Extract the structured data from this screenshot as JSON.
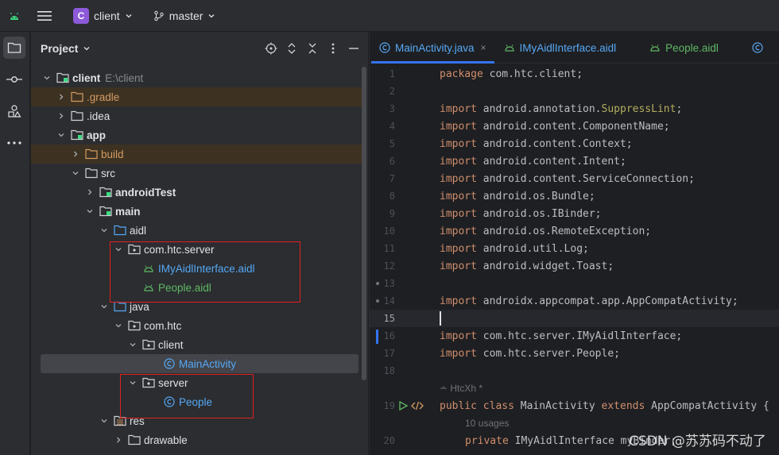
{
  "titlebar": {
    "project_initial": "C",
    "project_name": "client",
    "branch": "master"
  },
  "panel": {
    "title": "Project"
  },
  "tree": [
    {
      "label": "client",
      "path": "E:\\client"
    },
    {
      "label": ".gradle"
    },
    {
      "label": ".idea"
    },
    {
      "label": "app"
    },
    {
      "label": "build"
    },
    {
      "label": "src"
    },
    {
      "label": "androidTest"
    },
    {
      "label": "main"
    },
    {
      "label": "aidl"
    },
    {
      "label": "com.htc.server"
    },
    {
      "label": "IMyAidlInterface.aidl"
    },
    {
      "label": "People.aidl"
    },
    {
      "label": "java"
    },
    {
      "label": "com.htc"
    },
    {
      "label": "client"
    },
    {
      "label": "MainActivity"
    },
    {
      "label": "server"
    },
    {
      "label": "People"
    },
    {
      "label": "res"
    },
    {
      "label": "drawable"
    }
  ],
  "tabs": [
    {
      "label": "MainActivity.java",
      "close": "×"
    },
    {
      "label": "IMyAidlInterface.aidl"
    },
    {
      "label": "People.aidl"
    }
  ],
  "code": {
    "lines": [
      {
        "n": "1",
        "kw": "package",
        "rest": " com.htc.client;"
      },
      {
        "n": "2",
        "kw": "",
        "rest": ""
      },
      {
        "n": "3",
        "kw": "import",
        "rest": " android.annotation.",
        "ann": "SuppressLint",
        "tail": ";"
      },
      {
        "n": "4",
        "kw": "import",
        "rest": " android.content.ComponentName;"
      },
      {
        "n": "5",
        "kw": "import",
        "rest": " android.content.Context;"
      },
      {
        "n": "6",
        "kw": "import",
        "rest": " android.content.Intent;"
      },
      {
        "n": "7",
        "kw": "import",
        "rest": " android.content.ServiceConnection;"
      },
      {
        "n": "8",
        "kw": "import",
        "rest": " android.os.Bundle;"
      },
      {
        "n": "9",
        "kw": "import",
        "rest": " android.os.IBinder;"
      },
      {
        "n": "10",
        "kw": "import",
        "rest": " android.os.RemoteException;"
      },
      {
        "n": "11",
        "kw": "import",
        "rest": " android.util.Log;"
      },
      {
        "n": "12",
        "kw": "import",
        "rest": " android.widget.Toast;"
      },
      {
        "n": "13",
        "kw": "",
        "rest": ""
      },
      {
        "n": "14",
        "kw": "import",
        "rest": " androidx.appcompat.app.AppCompatActivity;"
      },
      {
        "n": "15",
        "kw": "",
        "rest": ""
      },
      {
        "n": "16",
        "kw": "import",
        "rest": " com.htc.server.IMyAidlInterface;"
      },
      {
        "n": "17",
        "kw": "import",
        "rest": " com.htc.server.People;"
      },
      {
        "n": "18",
        "kw": "",
        "rest": ""
      }
    ],
    "author_hint": "HtcXh *",
    "line19": {
      "n": "19",
      "kw1": "public",
      "kw2": "class",
      "name": " MainActivity ",
      "kw3": "extends",
      "rest": " AppCompatActivity {"
    },
    "usages_hint": "10 usages",
    "line20": {
      "n": "20",
      "kw": "private",
      "rest": " IMyAidlInterface myBinder;"
    }
  },
  "watermark": "CSDN @苏苏码不动了"
}
